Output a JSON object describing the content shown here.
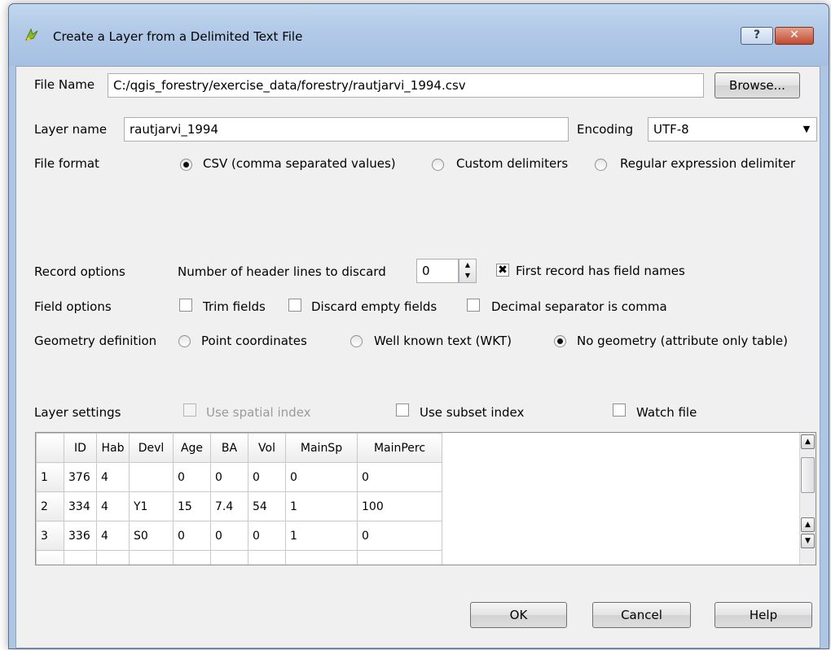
{
  "window": {
    "title": "Create a Layer from a Delimited Text File",
    "help_glyph": "?",
    "close_glyph": "✕"
  },
  "file_name": {
    "label": "File Name",
    "value": "C:/qgis_forestry/exercise_data/forestry/rautjarvi_1994.csv",
    "browse_label": "Browse..."
  },
  "layer_name": {
    "label": "Layer name",
    "value": "rautjarvi_1994",
    "encoding_label": "Encoding",
    "encoding_value": "UTF-8"
  },
  "file_format": {
    "label": "File format",
    "options": [
      {
        "label": "CSV (comma separated values)",
        "selected": true
      },
      {
        "label": "Custom delimiters",
        "selected": false
      },
      {
        "label": "Regular expression delimiter",
        "selected": false
      }
    ]
  },
  "record_options": {
    "label": "Record options",
    "header_lines_label": "Number of header lines to discard",
    "header_lines_value": "0",
    "first_record_label": "First record has field names",
    "first_record_checked": true
  },
  "field_options": {
    "label": "Field options",
    "trim": "Trim fields",
    "discard_empty": "Discard empty fields",
    "decimal_comma": "Decimal separator is comma"
  },
  "geometry": {
    "label": "Geometry definition",
    "point": "Point coordinates",
    "wkt": "Well known text (WKT)",
    "none": "No geometry (attribute only table)",
    "selected": "none"
  },
  "layer_settings": {
    "label": "Layer settings",
    "spatial_index": "Use spatial index",
    "subset_index": "Use subset index",
    "watch_file": "Watch file"
  },
  "table": {
    "columns": [
      "ID",
      "Hab",
      "Devl",
      "Age",
      "BA",
      "Vol",
      "MainSp",
      "MainPerc"
    ],
    "rows": [
      {
        "num": "1",
        "cells": [
          "376",
          "4",
          "",
          "0",
          "0",
          "0",
          "0",
          "0"
        ]
      },
      {
        "num": "2",
        "cells": [
          "334",
          "4",
          "Y1",
          "15",
          "7.4",
          "54",
          "1",
          "100"
        ]
      },
      {
        "num": "3",
        "cells": [
          "336",
          "4",
          "S0",
          "0",
          "0",
          "0",
          "1",
          "0"
        ]
      }
    ]
  },
  "buttons": {
    "ok": "OK",
    "cancel": "Cancel",
    "help": "Help"
  },
  "icons": {
    "app": "qgis-icon",
    "combo": "chevron-down-icon",
    "spin": "spin-arrows-icon"
  },
  "colors": {
    "title_bar": "#b1c9e7",
    "close_button": "#c14a31",
    "dialog_bg": "#f0f0f0"
  }
}
